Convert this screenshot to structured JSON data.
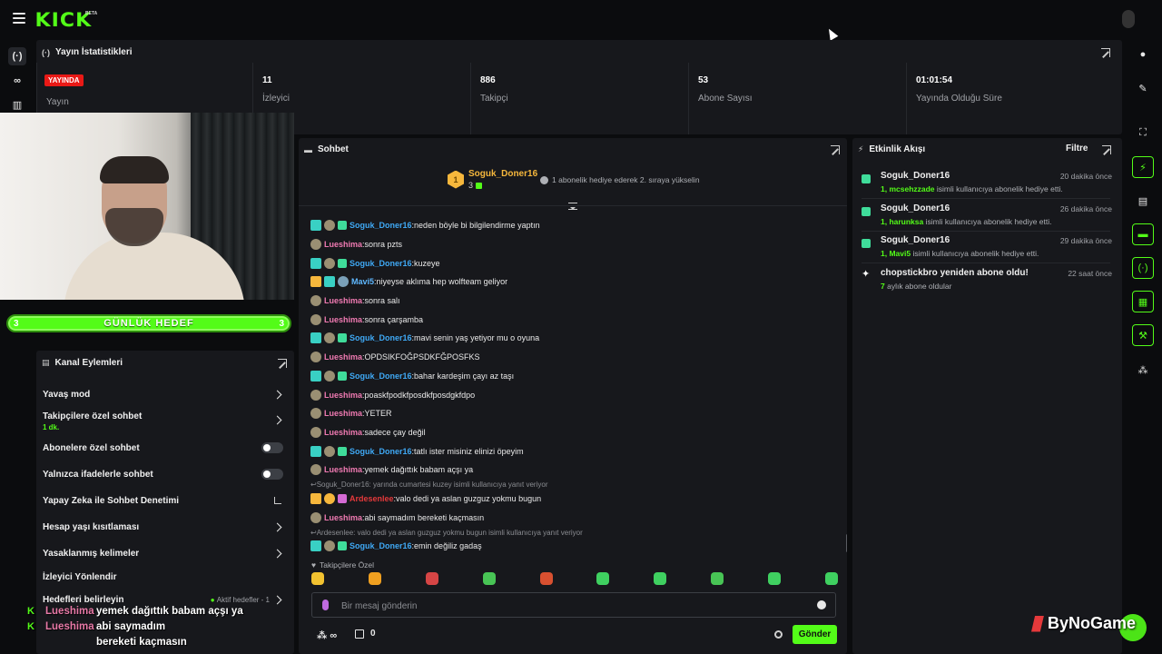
{
  "brand": {
    "logo": "KICK",
    "beta": "BETA",
    "accent": "#53fc18",
    "live_color": "#e91916"
  },
  "stats": {
    "title": "Yayın İstatistikleri",
    "live_badge": "YAYINDA",
    "cells": [
      {
        "value": "",
        "label": "Yayın"
      },
      {
        "value": "11",
        "label": "İzleyici"
      },
      {
        "value": "886",
        "label": "Takipçi"
      },
      {
        "value": "53",
        "label": "Abone Sayısı"
      },
      {
        "value": "01:01:54",
        "label": "Yayında Olduğu Süre"
      }
    ]
  },
  "goal": {
    "label": "GÜNLÜK HEDEF",
    "left": "3",
    "right": "3"
  },
  "channel_actions": {
    "title": "Kanal Eylemleri",
    "items": [
      {
        "label": "Yavaş mod",
        "sub": "",
        "control": "chevron"
      },
      {
        "label": "Takipçilere özel sohbet",
        "sub": "1 dk.",
        "control": "chevron"
      },
      {
        "label": "Abonelere özel sohbet",
        "sub": "",
        "control": "toggle"
      },
      {
        "label": "Yalnızca ifadelerle sohbet",
        "sub": "",
        "control": "toggle"
      },
      {
        "label": "Yapay Zeka ile Sohbet Denetimi",
        "sub": "",
        "control": "external"
      },
      {
        "label": "Hesap yaşı kısıtlaması",
        "sub": "",
        "control": "chevron"
      },
      {
        "label": "Yasaklanmış kelimeler",
        "sub": "",
        "control": "chevron"
      },
      {
        "label": "İzleyici Yönlendir",
        "sub": "",
        "control": "none"
      },
      {
        "label": "Hedefleri belirleyin",
        "sub": "",
        "control": "chevron"
      }
    ],
    "goals_status": "Aktif hedefler - 1"
  },
  "overlay_chat": [
    {
      "name": "Lueshima",
      "message": "yemek dağıttık babam açşı ya"
    },
    {
      "name": "Lueshima",
      "message": "abi saymadım bereketi kaçmasın"
    }
  ],
  "chat": {
    "title": "Sohbet",
    "pinned": {
      "rank": "1",
      "name": "Soguk_Doner16",
      "count": "3",
      "note": "1 abonelik hediye ederek 2. sıraya yükselin"
    },
    "messages": [
      {
        "user": "Soguk_Doner16",
        "color": "blue",
        "badges": [
          "sub",
          "og",
          "gift"
        ],
        "text": "neden böyle bi bilgilendirme yaptın",
        "reply": ""
      },
      {
        "user": "Lueshima",
        "color": "pink",
        "badges": [
          "og"
        ],
        "text": "sonra pzts",
        "reply": ""
      },
      {
        "user": "Soguk_Doner16",
        "color": "blue",
        "badges": [
          "sub",
          "og",
          "gift"
        ],
        "text": "kuzeye",
        "reply": ""
      },
      {
        "user": "Mavi5",
        "color": "sky",
        "badges": [
          "crown",
          "mod",
          "vip"
        ],
        "text": "niyeyse aklıma hep wolfteam geliyor",
        "reply": ""
      },
      {
        "user": "Lueshima",
        "color": "pink",
        "badges": [
          "og"
        ],
        "text": "sonra salı",
        "reply": ""
      },
      {
        "user": "Lueshima",
        "color": "pink",
        "badges": [
          "og"
        ],
        "text": "sonra çarşamba",
        "reply": ""
      },
      {
        "user": "Soguk_Doner16",
        "color": "blue",
        "badges": [
          "sub",
          "og",
          "gift"
        ],
        "text": "mavi senin yaş yetiyor mu o oyuna",
        "reply": ""
      },
      {
        "user": "Lueshima",
        "color": "pink",
        "badges": [
          "og"
        ],
        "text": "OPDSIKFOĞPSDKFĞPOSFKS",
        "reply": ""
      },
      {
        "user": "Soguk_Doner16",
        "color": "blue",
        "badges": [
          "sub",
          "og",
          "gift"
        ],
        "text": "bahar kardeşim çayı az taşı",
        "reply": ""
      },
      {
        "user": "Lueshima",
        "color": "pink",
        "badges": [
          "og"
        ],
        "text": "poaskfpodkfposdkfposdgkfdpo",
        "reply": ""
      },
      {
        "user": "Lueshima",
        "color": "pink",
        "badges": [
          "og"
        ],
        "text": "YETER",
        "reply": ""
      },
      {
        "user": "Lueshima",
        "color": "pink",
        "badges": [
          "og"
        ],
        "text": "sadece çay değil",
        "reply": ""
      },
      {
        "user": "Soguk_Doner16",
        "color": "blue",
        "badges": [
          "sub",
          "og",
          "gift"
        ],
        "text": "tatlı ister misiniz elinizi öpeyim",
        "reply": ""
      },
      {
        "user": "Lueshima",
        "color": "pink",
        "badges": [
          "og"
        ],
        "text": "yemek dağıttık babam açşı ya",
        "reply": ""
      },
      {
        "user": "Ardesenlee",
        "color": "red",
        "badges": [
          "crown",
          "one",
          "pink"
        ],
        "text": "valo dedi ya aslan guzguz yokmu bugun",
        "reply": "Soguk_Doner16: yarında cumartesi kuzey isimli kullanıcıya yanıt veriyor"
      },
      {
        "user": "Lueshima",
        "color": "pink",
        "badges": [
          "og"
        ],
        "text": "abi saymadım bereketi kaçmasın",
        "reply": ""
      },
      {
        "user": "Soguk_Doner16",
        "color": "blue",
        "badges": [
          "sub",
          "og",
          "gift"
        ],
        "text": "emin değiliz gadaş",
        "reply": "Ardesenlee: valo dedi ya aslan guzguz yokmu bugun isimli kullanıcıya yanıt veriyor"
      }
    ],
    "emote_section": "Takipçilere Özel",
    "emotes": [
      "#f2c230",
      "#f0a020",
      "#d64545",
      "#48c455",
      "#d85030",
      "#3fd060",
      "#3fd060",
      "#48c455",
      "#3fd060",
      "#3fd060"
    ],
    "input_placeholder": "Bir mesaj gönderin",
    "bits": "∞",
    "gift_count": "0",
    "send_label": "Gönder"
  },
  "activity": {
    "title": "Etkinlik Akışı",
    "filter": "Filtre",
    "items": [
      {
        "icon": "gift-icon",
        "name": "Soguk_Doner16",
        "time": "20 dakika önce",
        "highlight": "1, mcsehzzade",
        "desc": " isimli kullanıcıya abonelik hediye etti."
      },
      {
        "icon": "gift-icon",
        "name": "Soguk_Doner16",
        "time": "26 dakika önce",
        "highlight": "1, harunksa",
        "desc": " isimli kullanıcıya abonelik hediye etti."
      },
      {
        "icon": "gift-icon",
        "name": "Soguk_Doner16",
        "time": "29 dakika önce",
        "highlight": "1, Mavi5",
        "desc": " isimli kullanıcıya abonelik hediye etti."
      },
      {
        "icon": "sparkle-icon",
        "name": "chopstickbro yeniden abone oldu!",
        "time": "22 saat önce",
        "highlight": "7",
        "desc": " aylık abone oldular"
      }
    ]
  },
  "watermark": "ByNoGame"
}
